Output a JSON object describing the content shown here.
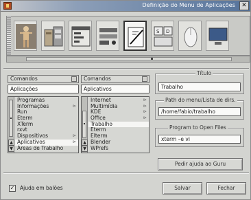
{
  "window": {
    "title": "Definição do Menu de Aplicações",
    "close_symbol": "✕"
  },
  "toolbar": {
    "icons": [
      "figure-icon",
      "cabinet-icon",
      "window-list-icon",
      "panel-icon",
      "menu-editor-icon",
      "sound-icon",
      "mouse-icon",
      "screen-icon"
    ],
    "active_index": 4
  },
  "left_column": {
    "combo_value": "Comandos",
    "path_value": "Aplicações",
    "items": [
      {
        "label": "Programas",
        "sub": ""
      },
      {
        "label": "Informações",
        "sub": "⊳"
      },
      {
        "label": "Run",
        "sub": ""
      },
      {
        "label": "Eterm",
        "sub": ""
      },
      {
        "label": "XTerm",
        "sub": ""
      },
      {
        "label": "rxvt",
        "sub": ""
      },
      {
        "label": "Dispositivos",
        "sub": "⊳"
      },
      {
        "label": "Aplicativos",
        "sub": "⊳"
      },
      {
        "label": "Áreas de Trabalho",
        "sub": ""
      }
    ],
    "selected_index": 7
  },
  "middle_column": {
    "combo_value": "Comandos",
    "path_value": "Aplicativos",
    "items": [
      {
        "label": "Internet",
        "sub": "⊳"
      },
      {
        "label": "Multimídia",
        "sub": "⊳"
      },
      {
        "label": "KDE",
        "sub": "⊳"
      },
      {
        "label": "Office",
        "sub": "⊳"
      },
      {
        "label": "Trabalho",
        "sub": ""
      },
      {
        "label": "Eterm",
        "sub": ""
      },
      {
        "label": "Elterm",
        "sub": ""
      },
      {
        "label": "Blender",
        "sub": ""
      },
      {
        "label": "WPrefs",
        "sub": ""
      }
    ],
    "selected_index": 4
  },
  "right_panel": {
    "title_label": "Título",
    "title_value": "Trabalho",
    "path_label": "Path do menu/Lista de dirs.",
    "path_value": "/home/fabio/trabalho",
    "program_label": "Program to Open Files",
    "program_value": "xterm –e vi",
    "guru_button": "Pedir ajuda ao Guru"
  },
  "footer": {
    "balloon_label": "Ajuda em balões",
    "balloon_checked": true,
    "check_mark": "✓",
    "save_button": "Salvar",
    "close_button": "Fechar"
  }
}
